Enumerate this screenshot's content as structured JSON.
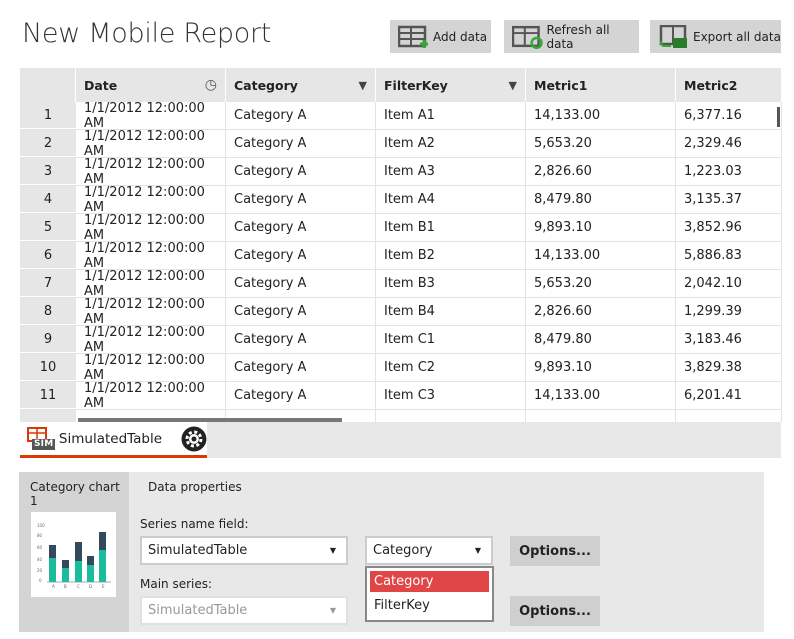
{
  "title": "New Mobile Report",
  "toolbar": {
    "add": "Add data",
    "refresh": "Refresh all data",
    "export": "Export all data"
  },
  "columns": [
    "",
    "Date",
    "Category",
    "FilterKey",
    "Metric1",
    "Metric2"
  ],
  "rows": [
    [
      "1",
      "1/1/2012 12:00:00 AM",
      "Category A",
      "Item A1",
      "14,133.00",
      "6,377.16"
    ],
    [
      "2",
      "1/1/2012 12:00:00 AM",
      "Category A",
      "Item A2",
      "5,653.20",
      "2,329.46"
    ],
    [
      "3",
      "1/1/2012 12:00:00 AM",
      "Category A",
      "Item A3",
      "2,826.60",
      "1,223.03"
    ],
    [
      "4",
      "1/1/2012 12:00:00 AM",
      "Category A",
      "Item A4",
      "8,479.80",
      "3,135.37"
    ],
    [
      "5",
      "1/1/2012 12:00:00 AM",
      "Category A",
      "Item B1",
      "9,893.10",
      "3,852.96"
    ],
    [
      "6",
      "1/1/2012 12:00:00 AM",
      "Category A",
      "Item B2",
      "14,133.00",
      "5,886.83"
    ],
    [
      "7",
      "1/1/2012 12:00:00 AM",
      "Category A",
      "Item B3",
      "5,653.20",
      "2,042.10"
    ],
    [
      "8",
      "1/1/2012 12:00:00 AM",
      "Category A",
      "Item B4",
      "2,826.60",
      "1,299.39"
    ],
    [
      "9",
      "1/1/2012 12:00:00 AM",
      "Category A",
      "Item C1",
      "8,479.80",
      "3,183.46"
    ],
    [
      "10",
      "1/1/2012 12:00:00 AM",
      "Category A",
      "Item C2",
      "9,893.10",
      "3,829.38"
    ],
    [
      "11",
      "1/1/2012 12:00:00 AM",
      "Category A",
      "Item C3",
      "14,133.00",
      "6,201.41"
    ]
  ],
  "tab": {
    "label": "SimulatedTable",
    "icon_text": "SIM"
  },
  "panel": {
    "left_tab": "Category chart 1",
    "right_tab": "Data properties",
    "series_label": "Series name field:",
    "series_value": "SimulatedTable",
    "field_value": "Category",
    "main_label": "Main series:",
    "main_value": "SimulatedTable",
    "options": "Options...",
    "dropdown": [
      "Category",
      "FilterKey"
    ]
  },
  "colors": {
    "accent": "#d83b01",
    "selected": "#e04646",
    "teal": "#1abc9c",
    "dark": "#34495e"
  }
}
